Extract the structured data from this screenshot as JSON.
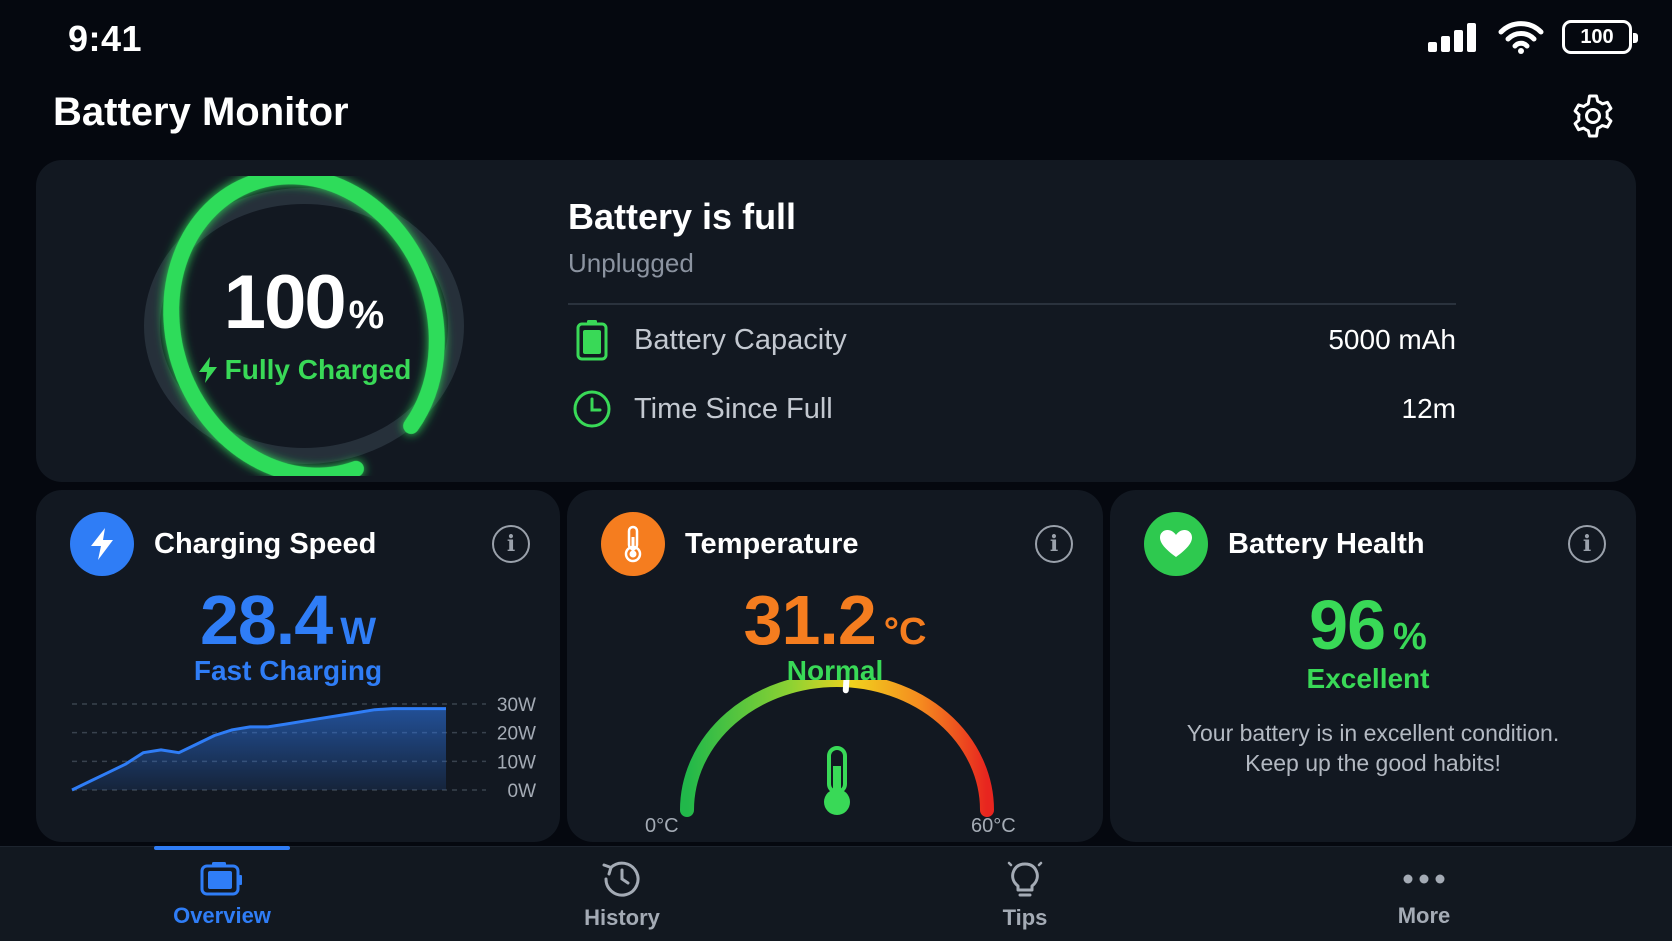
{
  "status_bar": {
    "time": "9:41",
    "battery_level": "100"
  },
  "app": {
    "title": "Battery Monitor",
    "settings_icon": "gear-icon"
  },
  "hero": {
    "percent": "100",
    "percent_unit": "%",
    "charge_fraction": 0.92,
    "charge_status": "Fully Charged",
    "title": "Battery is full",
    "subtitle": "Unplugged",
    "stats": [
      {
        "icon": "battery-icon",
        "label": "Battery Capacity",
        "value": "5000 mAh"
      },
      {
        "icon": "clock-icon",
        "label": "Time Since Full",
        "value": "12m"
      }
    ]
  },
  "charging_speed": {
    "title": "Charging Speed",
    "value": "28.4",
    "unit": "W",
    "status": "Fast Charging",
    "chart_ticks": [
      "30W",
      "20W",
      "10W",
      "0W"
    ]
  },
  "temperature": {
    "title": "Temperature",
    "value": "31.2",
    "unit": "°C",
    "status": "Normal",
    "gauge_min": "0°C",
    "gauge_max": "60°C",
    "gauge_position": 0.52
  },
  "battery_health": {
    "title": "Battery Health",
    "value": "96",
    "unit": "%",
    "status": "Excellent",
    "desc_line1": "Your battery is in excellent condition.",
    "desc_line2": "Keep up the good habits!"
  },
  "tabs": [
    {
      "label": "Overview",
      "icon": "battery-tab-icon",
      "active": true
    },
    {
      "label": "History",
      "icon": "history-icon",
      "active": false
    },
    {
      "label": "Tips",
      "icon": "lightbulb-icon",
      "active": false
    },
    {
      "label": "More",
      "icon": "more-dots-icon",
      "active": false
    }
  ],
  "colors": {
    "background": "#05080f",
    "card": "#121821",
    "green": "#39d957",
    "blue": "#2f7df6",
    "orange": "#f57d1f"
  },
  "chart_data": {
    "type": "area",
    "title": "",
    "xlabel": "",
    "ylabel": "",
    "ylim": [
      0,
      30
    ],
    "y_ticks": [
      "30W",
      "20W",
      "10W",
      "0W"
    ],
    "series": [
      {
        "values": [
          0,
          3,
          6,
          9,
          13,
          14,
          13,
          16,
          19,
          21,
          22,
          22,
          23,
          24,
          25,
          26,
          27,
          28,
          28.4,
          28.4,
          28.4,
          28.4
        ]
      }
    ]
  }
}
